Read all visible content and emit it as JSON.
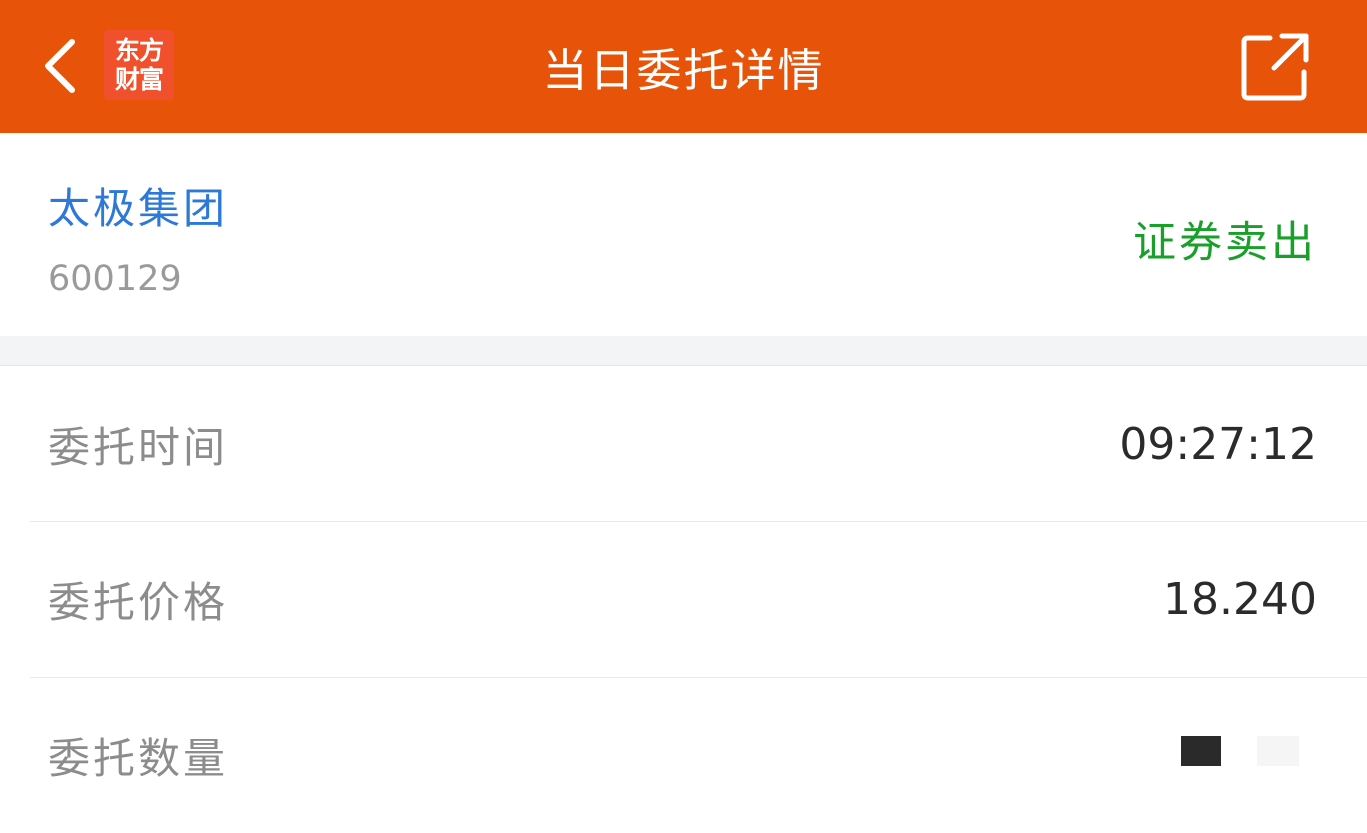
{
  "header": {
    "title": "当日委托详情",
    "logo_line1": "东方",
    "logo_line2": "财富",
    "back_icon": "chevron-left-icon",
    "share_icon": "share-external-icon"
  },
  "stock": {
    "name": "太极集团",
    "code": "600129",
    "trade_type": "证券卖出"
  },
  "details": [
    {
      "label": "委托时间",
      "value": "09:27:12"
    },
    {
      "label": "委托价格",
      "value": "18.240"
    },
    {
      "label": "委托数量",
      "value": ""
    }
  ],
  "colors": {
    "header_bg": "#e8530a",
    "stock_name": "#2e78d8",
    "trade_type": "#1a9f2a",
    "label": "#8c8c8c"
  }
}
